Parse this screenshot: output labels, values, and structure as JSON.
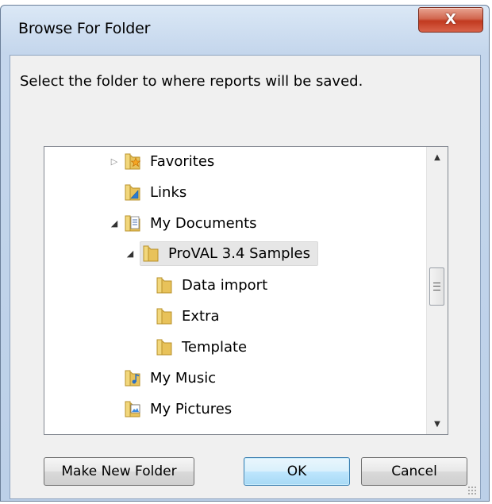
{
  "window": {
    "title": "Browse For Folder",
    "close_glyph": "X"
  },
  "instruction": "Select the folder to where reports will be saved.",
  "tree": {
    "nodes": [
      {
        "label": "Favorites",
        "expander": "▷",
        "icon": "favorites-folder-icon"
      },
      {
        "label": "Links",
        "expander": "",
        "icon": "links-folder-icon"
      },
      {
        "label": "My Documents",
        "expander": "◢",
        "icon": "documents-folder-icon"
      },
      {
        "label": "ProVAL 3.4 Samples",
        "expander": "◢",
        "icon": "folder-icon",
        "selected": true
      },
      {
        "label": "Data import",
        "expander": "",
        "icon": "folder-icon"
      },
      {
        "label": "Extra",
        "expander": "",
        "icon": "folder-icon"
      },
      {
        "label": "Template",
        "expander": "",
        "icon": "folder-icon"
      },
      {
        "label": "My Music",
        "expander": "",
        "icon": "music-folder-icon"
      },
      {
        "label": "My Pictures",
        "expander": "",
        "icon": "pictures-folder-icon"
      }
    ],
    "scroll_position": 0.48
  },
  "buttons": {
    "make_new_folder": "Make New Folder",
    "ok": "OK",
    "cancel": "Cancel"
  },
  "colors": {
    "folder": "#e8c25a",
    "selection": "#e6e6e6",
    "close_button": "#c8402a"
  }
}
